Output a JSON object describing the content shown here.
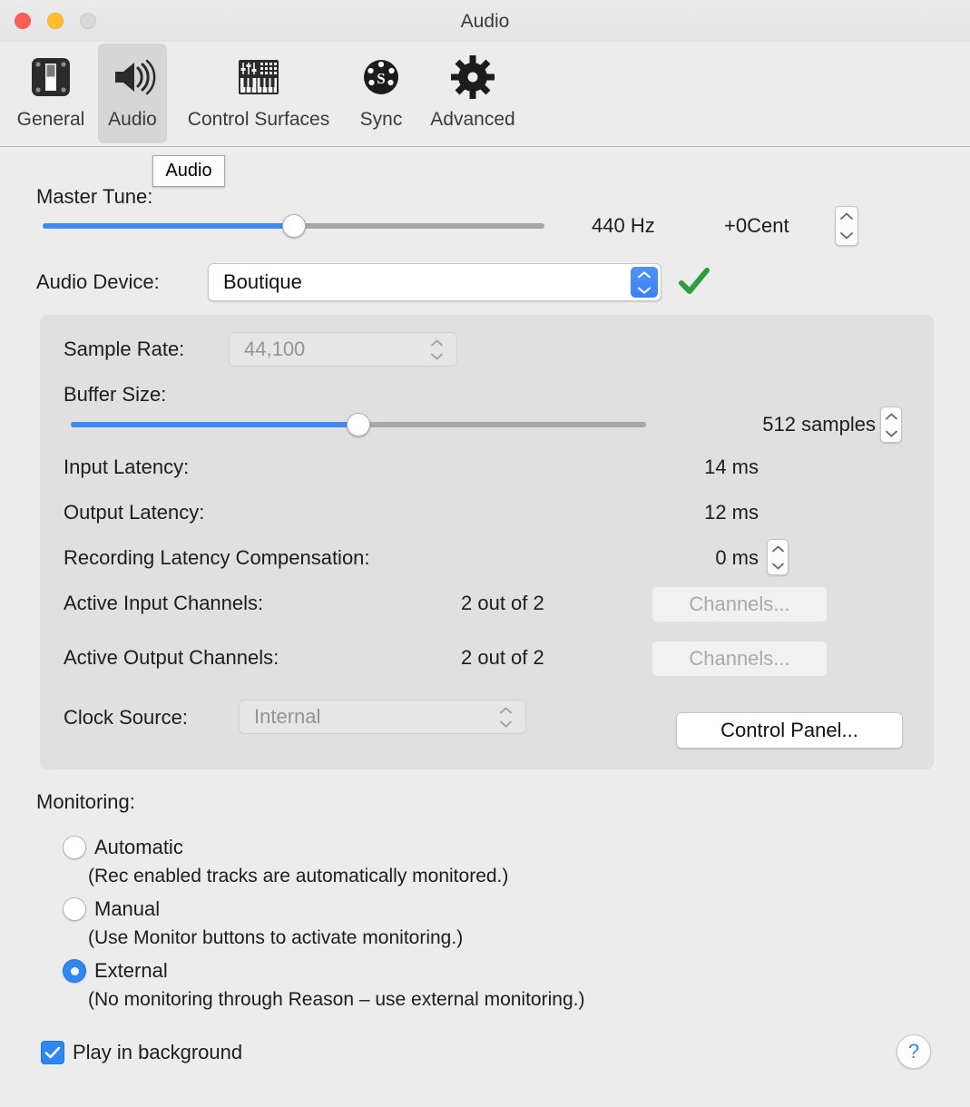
{
  "window": {
    "title": "Audio",
    "traffic_lights": [
      {
        "name": "close",
        "color": "#ff5f57"
      },
      {
        "name": "minimize",
        "color": "#febc2e"
      },
      {
        "name": "zoom",
        "color": "#d8d8d8"
      }
    ]
  },
  "toolbar": {
    "tabs": [
      {
        "label": "General",
        "icon": "fader-plate-icon",
        "selected": false
      },
      {
        "label": "Audio",
        "icon": "speaker-icon",
        "selected": true
      },
      {
        "label": "Control Surfaces",
        "icon": "midi-keyboard-icon",
        "selected": false
      },
      {
        "label": "Sync",
        "icon": "midi-din-icon",
        "selected": false
      },
      {
        "label": "Advanced",
        "icon": "gear-icon",
        "selected": false
      }
    ],
    "tooltip": "Audio"
  },
  "master_tune": {
    "label": "Master Tune:",
    "slider_percent": 50,
    "frequency": "440 Hz",
    "cent": "+0Cent"
  },
  "audio_device": {
    "label": "Audio Device:",
    "value": "Boutique",
    "status_icon": "green-checkmark-icon",
    "status_color": "#2e9e3e"
  },
  "device_panel": {
    "sample_rate": {
      "label": "Sample Rate:",
      "value": "44,100",
      "enabled": false
    },
    "buffer_size": {
      "label": "Buffer Size:",
      "slider_percent": 50,
      "value": "512 samples"
    },
    "input_latency": {
      "label": "Input Latency:",
      "value": "14 ms"
    },
    "output_latency": {
      "label": "Output Latency:",
      "value": "12 ms"
    },
    "recording_latency_compensation": {
      "label": "Recording Latency Compensation:",
      "value": "0 ms"
    },
    "active_input_channels": {
      "label": "Active Input Channels:",
      "value": "2 out of 2",
      "button": "Channels...",
      "button_enabled": false
    },
    "active_output_channels": {
      "label": "Active Output Channels:",
      "value": "2 out of 2",
      "button": "Channels...",
      "button_enabled": false
    },
    "clock_source": {
      "label": "Clock Source:",
      "value": "Internal",
      "enabled": false
    },
    "control_panel_button": "Control Panel..."
  },
  "monitoring": {
    "label": "Monitoring:",
    "options": [
      {
        "label": "Automatic",
        "description": "(Rec enabled tracks are automatically monitored.)",
        "selected": false
      },
      {
        "label": "Manual",
        "description": "(Use Monitor buttons to activate monitoring.)",
        "selected": false
      },
      {
        "label": "External",
        "description": "(No monitoring through Reason – use external monitoring.)",
        "selected": true
      }
    ]
  },
  "footer": {
    "play_in_background": {
      "label": "Play in background",
      "checked": true
    },
    "help_button": "?"
  },
  "colors": {
    "accent_blue": "#3e8bf5",
    "window_bg": "#ececec",
    "group_bg": "#e0e0e0",
    "selected_tab_bg": "#d6d6d6"
  }
}
